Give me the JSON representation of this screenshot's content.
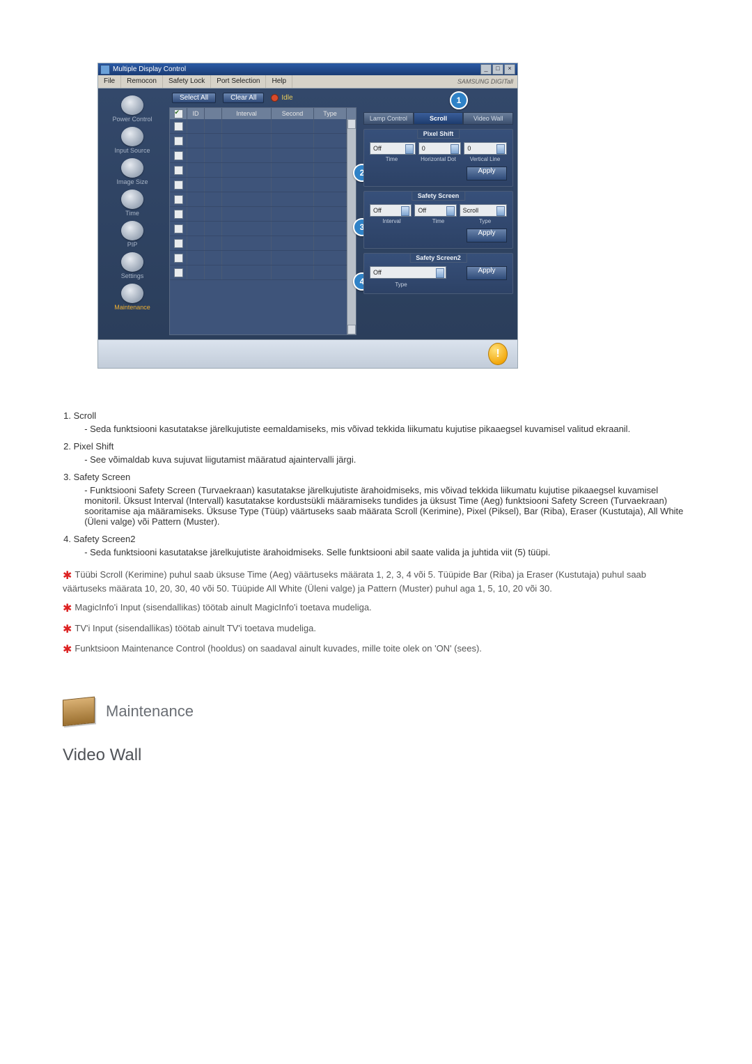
{
  "window": {
    "title": "Multiple Display Control",
    "winbtns": {
      "min": "_",
      "max": "□",
      "close": "×"
    },
    "menus": [
      "File",
      "Remocon",
      "Safety Lock",
      "Port Selection",
      "Help"
    ],
    "brand": "SAMSUNG DIGITall"
  },
  "leftnav": [
    {
      "label": "Power Control"
    },
    {
      "label": "Input Source"
    },
    {
      "label": "Image Size"
    },
    {
      "label": "Time"
    },
    {
      "label": "PIP"
    },
    {
      "label": "Settings"
    },
    {
      "label": "Maintenance",
      "active": true
    }
  ],
  "toolbar": {
    "select_all": "Select All",
    "clear_all": "Clear All",
    "idle": "Idle"
  },
  "grid": {
    "headers": {
      "id": "ID",
      "interval": "Interval",
      "second": "Second",
      "type": "Type"
    }
  },
  "tabs": {
    "lamp": "Lamp Control",
    "scroll": "Scroll",
    "video_wall": "Video Wall"
  },
  "panels": {
    "pixel_shift": {
      "title": "Pixel Shift",
      "off": "Off",
      "v1": "0",
      "v2": "0",
      "sub": {
        "time": "Time",
        "hdot": "Horizontal Dot",
        "vline": "Vertical Line"
      },
      "apply": "Apply"
    },
    "safety_screen": {
      "title": "Safety Screen",
      "off": "Off",
      "off2": "Off",
      "scroll": "Scroll",
      "sub": {
        "interval": "Interval",
        "time": "Time",
        "type": "Type"
      },
      "apply": "Apply"
    },
    "safety_screen2": {
      "title": "Safety Screen2",
      "off": "Off",
      "sub": {
        "type": "Type"
      },
      "apply": "Apply"
    }
  },
  "badges": {
    "b1": "1",
    "b2": "2",
    "b3": "3",
    "b4": "4"
  },
  "status": {
    "warn": "!"
  },
  "content": {
    "i1_h": "Scroll",
    "i1_t": "Seda funktsiooni kasutatakse järelkujutiste eemaldamiseks, mis võivad tekkida liikumatu kujutise pikaaegsel kuvamisel valitud ekraanil.",
    "i2_h": "Pixel Shift",
    "i2_t": "See võimaldab kuva sujuvat liigutamist määratud ajaintervalli järgi.",
    "i3_h": "Safety Screen",
    "i3_t": "Funktsiooni Safety Screen (Turvaekraan) kasutatakse järelkujutiste ärahoidmiseks, mis võivad tekkida liikumatu kujutise pikaaegsel kuvamisel monitoril.  Üksust Interval (Intervall) kasutatakse kordustsükli määramiseks tundides ja üksust Time (Aeg) funktsiooni Safety Screen (Turvaekraan) sooritamise aja määramiseks. Üksuse Type (Tüüp) väärtuseks saab määrata Scroll (Kerimine), Pixel (Piksel), Bar (Riba), Eraser (Kustutaja), All White (Üleni valge) või Pattern (Muster).",
    "i4_h": "Safety Screen2",
    "i4_t": "Seda funktsiooni kasutatakse järelkujutiste ärahoidmiseks. Selle funktsiooni abil saate valida ja juhtida viit (5) tüüpi.",
    "n1": "Tüübi Scroll (Kerimine) puhul saab üksuse Time (Aeg) väärtuseks määrata 1, 2, 3, 4 või 5. Tüüpide Bar (Riba) ja Eraser (Kustutaja) puhul saab väärtuseks määrata 10, 20, 30, 40 või 50. Tüüpide All White (Üleni valge) ja Pattern (Muster) puhul aga 1, 5, 10, 20 või 30.",
    "n2": "MagicInfo'i Input (sisendallikas) töötab ainult MagicInfo'i toetava mudeliga.",
    "n3": "TV'i Input (sisendallikas) töötab ainult TV'i toetava mudeliga.",
    "n4": "Funktsioon Maintenance Control (hooldus) on saadaval ainult kuvades, mille toite olek on 'ON' (sees)."
  },
  "section": {
    "maintenance": "Maintenance",
    "video_wall": "Video Wall"
  }
}
